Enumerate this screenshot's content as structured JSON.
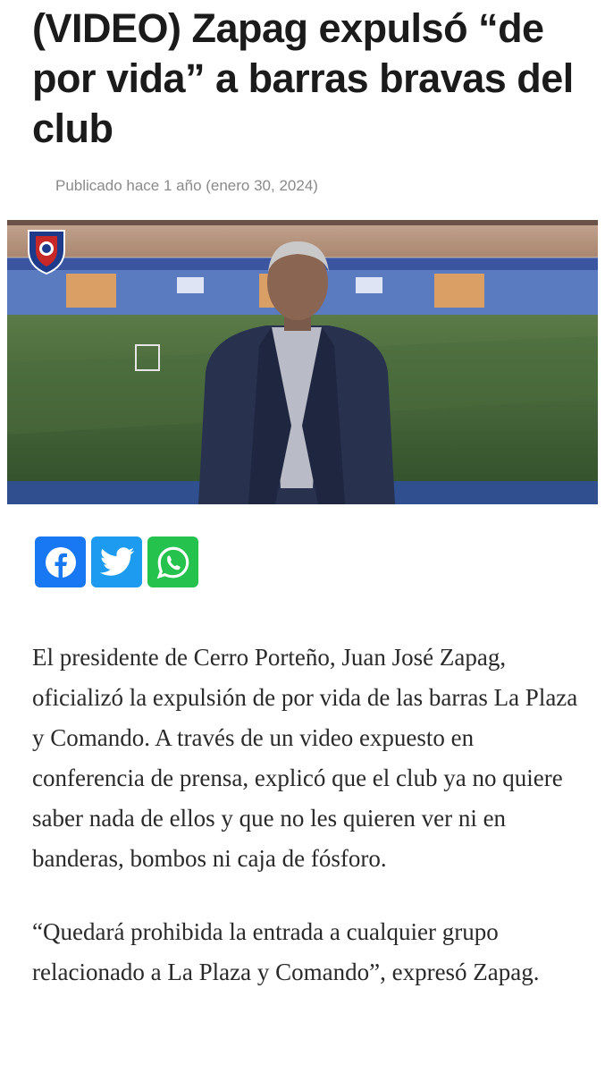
{
  "article": {
    "title": "(VIDEO) Zapag expulsó “de por vida” a barras bravas del club",
    "published": "Publicado hace 1 año (enero 30, 2024)",
    "paragraphs": [
      "El presidente de Cerro Porteño, Juan José Zapag, oficializó la expulsión de por vida de las barras La Plaza y Comando. A través de un video expuesto en conferencia de prensa, explicó que el club ya no quiere saber nada de ellos y que no les quieren ver ni en banderas, bombos ni caja de fósforo.",
      "“Quedará prohibida la entrada a cualquier grupo relacionado a La Plaza y Comando”, expresó Zapag."
    ]
  },
  "share": [
    {
      "network": "Facebook",
      "icon": "facebook-icon",
      "color": "#1877f2"
    },
    {
      "network": "Twitter",
      "icon": "twitter-icon",
      "color": "#1d9bf0"
    },
    {
      "network": "WhatsApp",
      "icon": "whatsapp-icon",
      "color": "#25c24e"
    }
  ],
  "video": {
    "content": "man in dark suit speaking in front of a stadium pitch",
    "club_crest": "cerro-porteno-crest"
  }
}
